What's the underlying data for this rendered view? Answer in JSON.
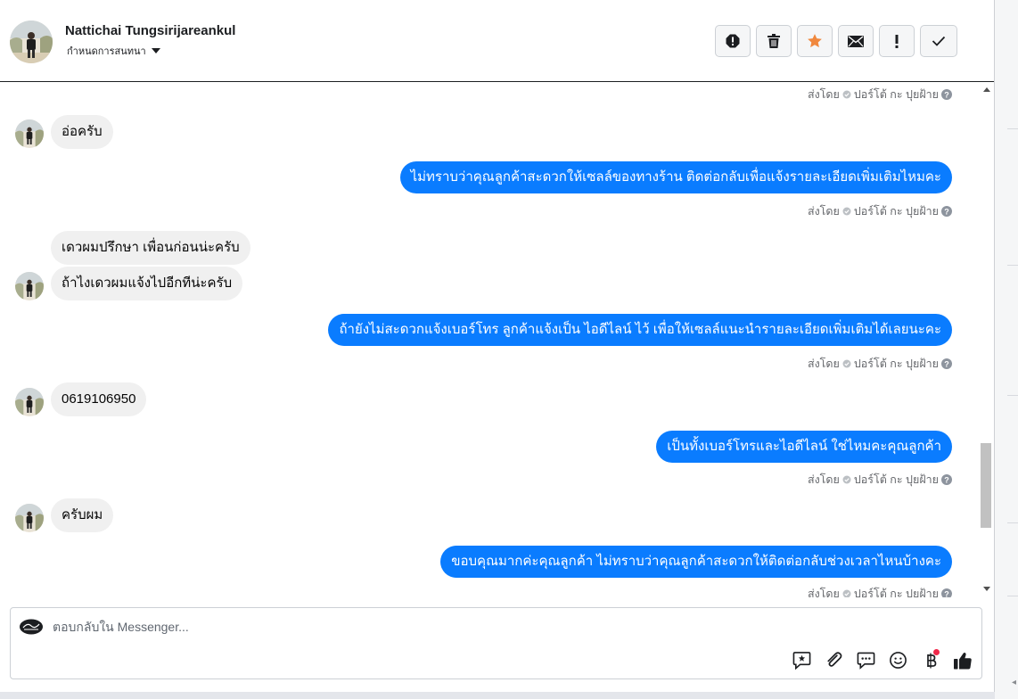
{
  "header": {
    "contact_name": "Nattichai Tungsirijareankul",
    "assign_label": "กำหนดการสนทนา",
    "actions": [
      "report-icon",
      "trash-icon",
      "star-icon",
      "envelope-icon",
      "exclamation-icon",
      "check-icon"
    ]
  },
  "messages": [
    {
      "direction": "out_meta_only",
      "sent_by": "ส่งโดย",
      "sender": "ปอร์โต้ กะ ปุยฝ้าย"
    },
    {
      "direction": "in",
      "text": "อ่อครับ"
    },
    {
      "direction": "out",
      "text": "ไม่ทราบว่าคุณลูกค้าสะดวกให้เซลล์ของทางร้าน ติดต่อกลับเพื่อแจ้งรายละเอียดเพิ่มเติมไหมคะ",
      "sent_by": "ส่งโดย",
      "sender": "ปอร์โต้ กะ ปุยฝ้าย"
    },
    {
      "direction": "in",
      "text": "เดวผมปรึกษา เพื่อนก่อนน่ะครับ"
    },
    {
      "direction": "in",
      "text": "ถ้าไงเดวผมแจ้งไปอีกทีน่ะครับ"
    },
    {
      "direction": "out",
      "text": "ถ้ายังไม่สะดวกแจ้งเบอร์โทร  ลูกค้าแจ้งเป็น ไอดีไลน์ ไว้ เพื่อให้เซลล์แนะนำรายละเอียดเพิ่มเติมได้เลยนะคะ",
      "sent_by": "ส่งโดย",
      "sender": "ปอร์โต้ กะ ปุยฝ้าย"
    },
    {
      "direction": "in",
      "text": "0619106950"
    },
    {
      "direction": "out",
      "text": "เป็นทั้งเบอร์โทรและไอดีไลน์ ใช่ไหมคะคุณลูกค้า",
      "sent_by": "ส่งโดย",
      "sender": "ปอร์โต้ กะ ปุยฝ้าย"
    },
    {
      "direction": "in",
      "text": "ครับผม"
    },
    {
      "direction": "out",
      "text": "ขอบคุณมากค่ะคุณลูกค้า ไม่ทราบว่าคุณลูกค้าสะดวกให้ติดต่อกลับช่วงเวลาไหนบ้างคะ",
      "sent_by": "ส่งโดย",
      "sender": "ปอร์โต้ กะ ปุยฝ้าย"
    }
  ],
  "composer": {
    "placeholder": "ตอบกลับใน Messenger...",
    "value": "",
    "tools": [
      "saved-reply-icon",
      "attachment-icon",
      "chat-icon",
      "emoji-icon",
      "baht-payment-icon",
      "thumbs-up-icon"
    ]
  },
  "colors": {
    "outgoing_bubble": "#0a7cff",
    "incoming_bubble": "#f0f0f0",
    "star": "#f0883e",
    "notification_dot": "#f02849"
  }
}
